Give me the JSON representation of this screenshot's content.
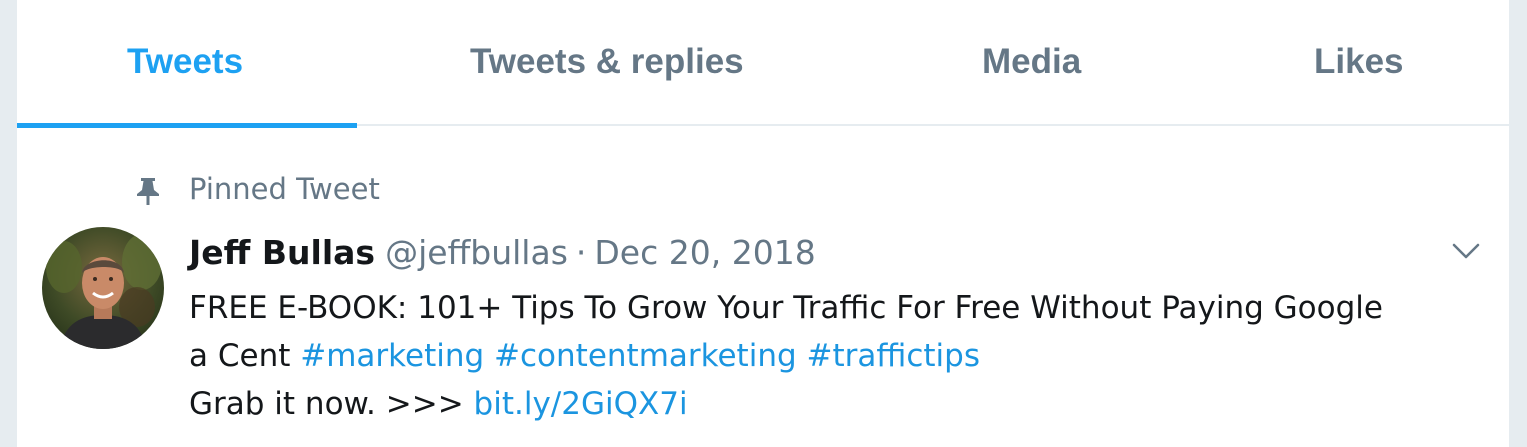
{
  "tabs": [
    {
      "label": "Tweets",
      "active": true
    },
    {
      "label": "Tweets & replies",
      "active": false
    },
    {
      "label": "Media",
      "active": false
    },
    {
      "label": "Likes",
      "active": false
    }
  ],
  "pinned": {
    "label": "Pinned Tweet",
    "icon": "pin-icon"
  },
  "tweet": {
    "author_name": "Jeff Bullas",
    "handle": "@jeffbullas",
    "separator": "·",
    "date": "Dec 20, 2018",
    "text_line1": "FREE E-BOOK: 101+ Tips To Grow Your Traffic For Free Without Paying Google",
    "text_line2_prefix": "a Cent",
    "hashtags": [
      "#marketing",
      "#contentmarketing",
      "#traffictips"
    ],
    "text_line3_prefix": "Grab it now. >>>",
    "link": "bit.ly/2GiQX7i",
    "menu_icon": "chevron-down-icon"
  },
  "colors": {
    "accent": "#1da1f2",
    "link": "#1b95e0",
    "secondary_text": "#657786",
    "primary_text": "#14171a",
    "divider": "#e6ecf0"
  }
}
